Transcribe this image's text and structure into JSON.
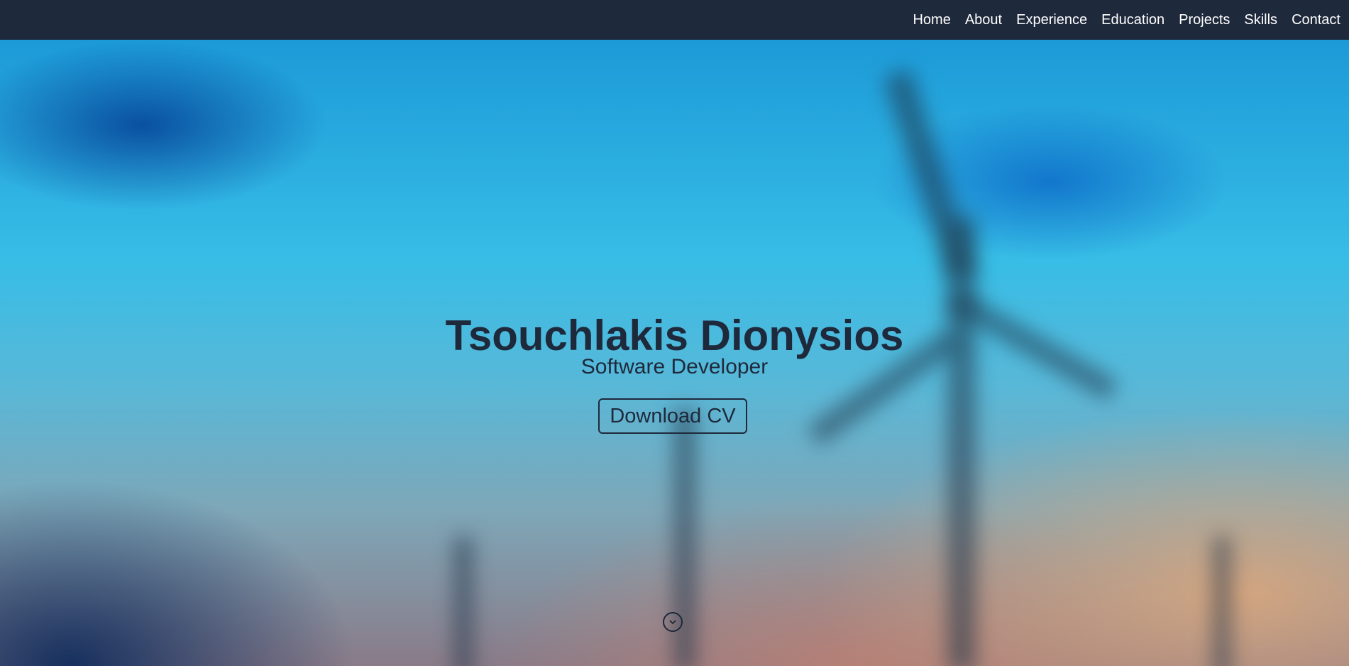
{
  "nav": {
    "items": [
      {
        "label": "Home"
      },
      {
        "label": "About"
      },
      {
        "label": "Experience"
      },
      {
        "label": "Education"
      },
      {
        "label": "Projects"
      },
      {
        "label": "Skills"
      },
      {
        "label": "Contact"
      }
    ]
  },
  "hero": {
    "title": "Tsouchlakis Dionysios",
    "subtitle": "Software Developer",
    "cta_label": "Download CV",
    "scroll_icon": "chevron-down-circle-icon"
  },
  "colors": {
    "nav_bg": "#1e293b",
    "text_dark": "#1e293b",
    "nav_text": "#ffffff"
  }
}
